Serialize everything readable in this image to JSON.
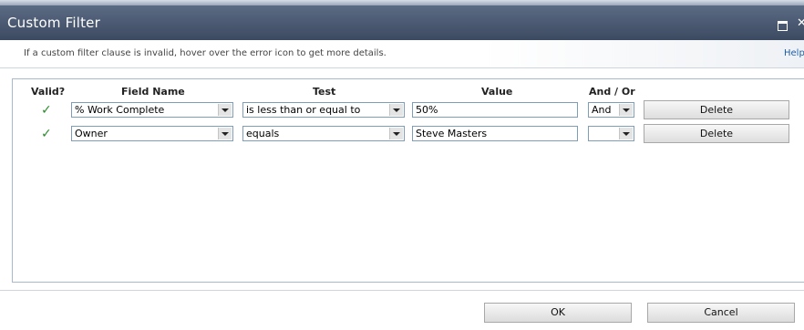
{
  "dialog": {
    "title": "Custom Filter",
    "info": "If a custom filter clause is invalid, hover over the error icon to get more details.",
    "help_label": "Help"
  },
  "columns": {
    "valid": "Valid?",
    "field_name": "Field Name",
    "test": "Test",
    "value": "Value",
    "and_or": "And / Or"
  },
  "rows": [
    {
      "valid": "✓",
      "field": "% Work Complete",
      "test": "is less than or equal to",
      "value": "50%",
      "and_or": "And",
      "delete_label": "Delete"
    },
    {
      "valid": "✓",
      "field": "Owner",
      "test": "equals",
      "value": "Steve Masters",
      "and_or": "",
      "delete_label": "Delete"
    }
  ],
  "footer": {
    "ok_label": "OK",
    "cancel_label": "Cancel"
  }
}
